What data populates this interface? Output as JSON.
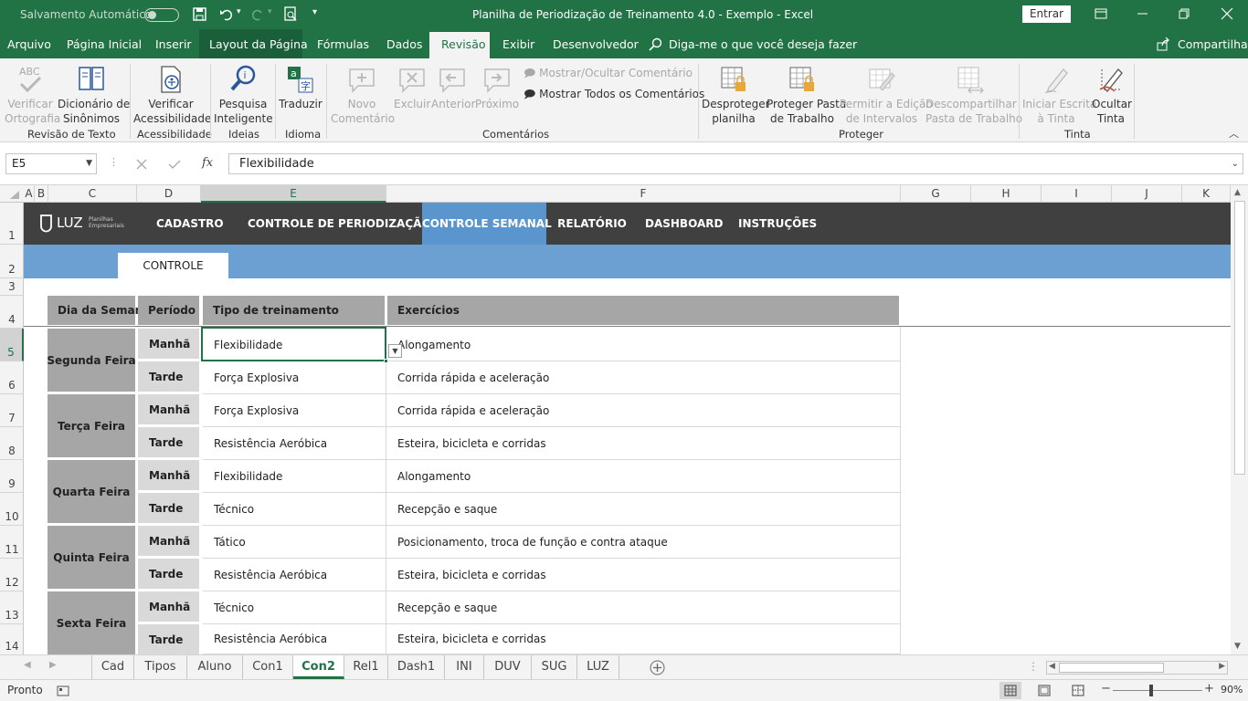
{
  "title_bar": {
    "autosave_label": "Salvamento Automático",
    "window_title": "Planilha de Periodização de Treinamento 4.0 - Exemplo  -  Excel",
    "signin_label": "Entrar"
  },
  "menu": {
    "tabs": [
      "Arquivo",
      "Página Inicial",
      "Inserir",
      "Layout da Página",
      "Fórmulas",
      "Dados",
      "Revisão",
      "Exibir",
      "Desenvolvedor"
    ],
    "active_tab": "Revisão",
    "tell_me": "Diga-me o que você deseja fazer",
    "share": "Compartilhar"
  },
  "ribbon": {
    "groups": {
      "revisao_texto": "Revisão de Texto",
      "acessibilidade": "Acessibilidade",
      "ideias": "Ideias",
      "idioma": "Idioma",
      "comentarios": "Comentários",
      "proteger": "Proteger",
      "tinta": "Tinta"
    },
    "buttons": {
      "verificar_ortografia_1": "Verificar",
      "verificar_ortografia_2": "Ortografia",
      "dicionario_1": "Dicionário de",
      "dicionario_2": "Sinônimos",
      "acess_1": "Verificar",
      "acess_2": "Acessibilidade",
      "pesquisa_1": "Pesquisa",
      "pesquisa_2": "Inteligente",
      "traduzir": "Traduzir",
      "novo_1": "Novo",
      "novo_2": "Comentário",
      "excluir": "Excluir",
      "anterior": "Anterior",
      "proximo": "Próximo",
      "mostrar_ocultar": "Mostrar/Ocultar Comentário",
      "mostrar_todos": "Mostrar Todos os Comentários",
      "desproteger_1": "Desproteger",
      "desproteger_2": "planilha",
      "proteger_pasta_1": "Proteger Pasta",
      "proteger_pasta_2": "de Trabalho",
      "permitir_1": "Permitir a Edição",
      "permitir_2": "de Intervalos",
      "descompartilhar_1": "Descompartilhar",
      "descompartilhar_2": "Pasta de Trabalho",
      "iniciar_1": "Iniciar Escrita",
      "iniciar_2": "à Tinta",
      "ocultar_1": "Ocultar",
      "ocultar_2": "Tinta"
    },
    "abc": "ABC"
  },
  "formula_bar": {
    "name_box": "E5",
    "fx": "fx",
    "value": "Flexibilidade"
  },
  "columns": [
    "A",
    "B",
    "C",
    "D",
    "E",
    "F",
    "G",
    "H",
    "I",
    "J",
    "K"
  ],
  "rows": [
    "1",
    "2",
    "3",
    "4",
    "5",
    "6",
    "7",
    "8",
    "9",
    "10",
    "11",
    "12",
    "13",
    "14"
  ],
  "sheet_nav": {
    "logo_text": "LUZ",
    "logo_sub_1": "Planilhas",
    "logo_sub_2": "Empresariais",
    "items": [
      "CADASTRO",
      "CONTROLE DE PERIODIZAÇÃO",
      "CONTROLE SEMANAL",
      "RELATÓRIO",
      "DASHBOARD",
      "INSTRUÇÕES"
    ],
    "active": "CONTROLE SEMANAL",
    "sub_tab": "CONTROLE"
  },
  "table": {
    "headers": [
      "Dia da Semana",
      "Período",
      "Tipo de treinamento",
      "Exercícios"
    ],
    "days": [
      "Segunda Feira",
      "Terça Feira",
      "Quarta Feira",
      "Quinta Feira",
      "Sexta Feira"
    ],
    "rows": [
      {
        "periodo": "Manhã",
        "tipo": "Flexibilidade",
        "exercicios": "Alongamento"
      },
      {
        "periodo": "Tarde",
        "tipo": "Força Explosiva",
        "exercicios": "Corrida rápida e aceleração"
      },
      {
        "periodo": "Manhã",
        "tipo": "Força Explosiva",
        "exercicios": "Corrida rápida e aceleração"
      },
      {
        "periodo": "Tarde",
        "tipo": "Resistência Aeróbica",
        "exercicios": "Esteira, bicicleta e corridas"
      },
      {
        "periodo": "Manhã",
        "tipo": "Flexibilidade",
        "exercicios": "Alongamento"
      },
      {
        "periodo": "Tarde",
        "tipo": "Técnico",
        "exercicios": "Recepção e saque"
      },
      {
        "periodo": "Manhã",
        "tipo": "Tático",
        "exercicios": "Posicionamento, troca de função e contra ataque"
      },
      {
        "periodo": "Tarde",
        "tipo": "Resistência Aeróbica",
        "exercicios": "Esteira, bicicleta e corridas"
      },
      {
        "periodo": "Manhã",
        "tipo": "Técnico",
        "exercicios": "Recepção e saque"
      },
      {
        "periodo": "Tarde",
        "tipo": "Resistência Aeróbica",
        "exercicios": "Esteira, bicicleta e corridas"
      }
    ]
  },
  "sheet_tabs": [
    "Cad",
    "Tipos",
    "Aluno",
    "Con1",
    "Con2",
    "Rel1",
    "Dash1",
    "INI",
    "DUV",
    "SUG",
    "LUZ"
  ],
  "active_sheet": "Con2",
  "status": {
    "ready": "Pronto",
    "zoom": "90%"
  },
  "colors": {
    "excel_green": "#217346",
    "nav_dark": "#404040",
    "nav_active": "#5b95cd",
    "band_blue": "#6c9fd2",
    "header_gray": "#a6a6a6",
    "period_gray": "#d9d9d9"
  }
}
